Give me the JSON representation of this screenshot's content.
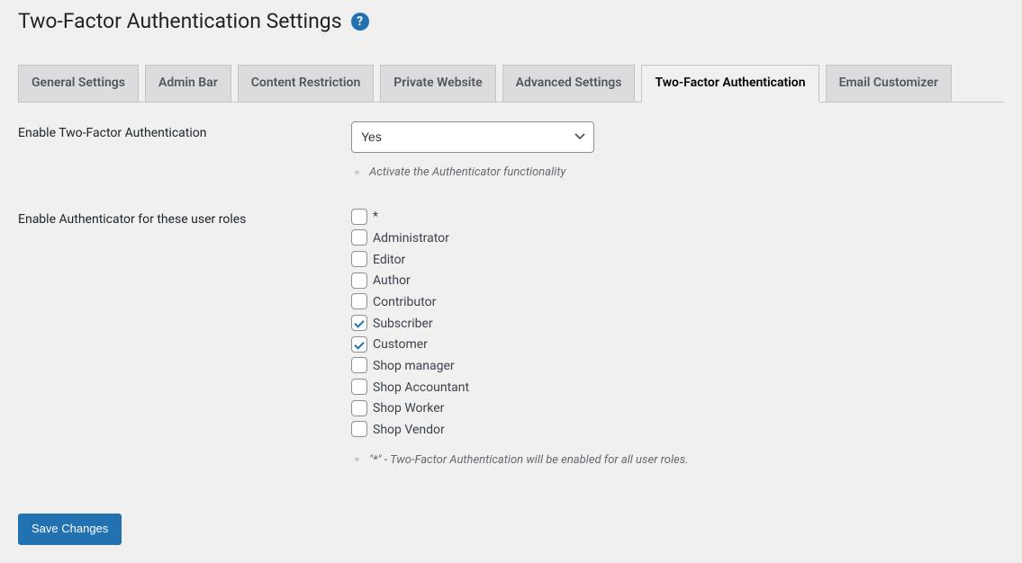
{
  "header": {
    "title": "Two-Factor Authentication Settings"
  },
  "tabs": [
    {
      "label": "General Settings",
      "active": false
    },
    {
      "label": "Admin Bar",
      "active": false
    },
    {
      "label": "Content Restriction",
      "active": false
    },
    {
      "label": "Private Website",
      "active": false
    },
    {
      "label": "Advanced Settings",
      "active": false
    },
    {
      "label": "Two-Factor Authentication",
      "active": true
    },
    {
      "label": "Email Customizer",
      "active": false
    }
  ],
  "enable_2fa": {
    "label": "Enable Two-Factor Authentication",
    "value": "Yes",
    "help": "Activate the Authenticator functionality"
  },
  "enable_roles": {
    "label": "Enable Authenticator for these user roles",
    "roles": [
      {
        "id": "all",
        "label": "*",
        "checked": false
      },
      {
        "id": "administrator",
        "label": "Administrator",
        "checked": false
      },
      {
        "id": "editor",
        "label": "Editor",
        "checked": false
      },
      {
        "id": "author",
        "label": "Author",
        "checked": false
      },
      {
        "id": "contributor",
        "label": "Contributor",
        "checked": false
      },
      {
        "id": "subscriber",
        "label": "Subscriber",
        "checked": true
      },
      {
        "id": "customer",
        "label": "Customer",
        "checked": true
      },
      {
        "id": "shop_manager",
        "label": "Shop manager",
        "checked": false
      },
      {
        "id": "shop_accountant",
        "label": "Shop Accountant",
        "checked": false
      },
      {
        "id": "shop_worker",
        "label": "Shop Worker",
        "checked": false
      },
      {
        "id": "shop_vendor",
        "label": "Shop Vendor",
        "checked": false
      }
    ],
    "help": "\"*\" - Two-Factor Authentication will be enabled for all user roles."
  },
  "save": {
    "label": "Save Changes"
  }
}
